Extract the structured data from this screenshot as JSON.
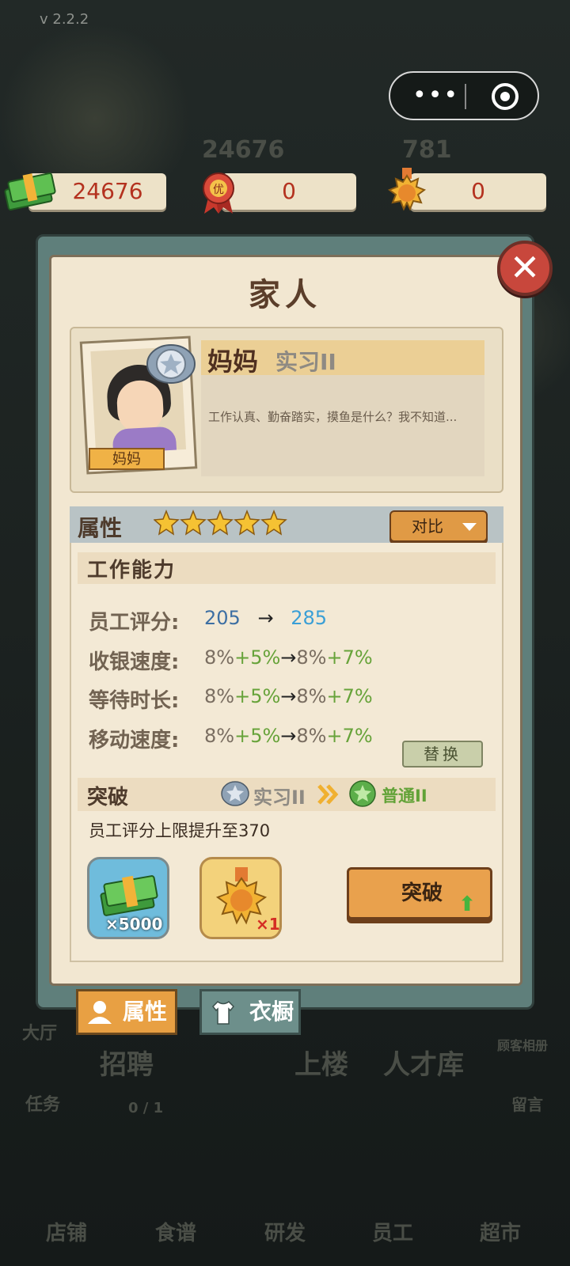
{
  "app": {
    "version": "v 2.2.2"
  },
  "background_hud": {
    "cash_dim": "24676",
    "gems_dim": "781",
    "nav_labels": [
      "店铺",
      "食谱",
      "研发",
      "员工",
      "超市"
    ],
    "side_left": [
      "大厅",
      "任务"
    ],
    "side_right": [
      "顾客相册",
      "留言"
    ],
    "buttons": [
      "招聘",
      "上楼",
      "人才库"
    ],
    "recruit_count": "0 / 1"
  },
  "resources": {
    "cash": "24676",
    "coupon": "0",
    "medal": "0"
  },
  "dialog": {
    "title": "家人",
    "profile": {
      "photo_label": "妈妈",
      "name": "妈妈",
      "rank": "实习II",
      "description": "工作认真、勤奋踏实，摸鱼是什么？我不知道..."
    },
    "attributes": {
      "title": "属性",
      "stars": 5,
      "compare_label": "对比",
      "section_title": "工作能力",
      "stats": [
        {
          "label": "员工评分:",
          "base": "205",
          "arrow": "→",
          "new": "285"
        },
        {
          "label": "收银速度:",
          "base": "8%",
          "bonus": "+5%",
          "arrow": "→",
          "new_base": "8%",
          "new_bonus": "+7%"
        },
        {
          "label": "等待时长:",
          "base": "8%",
          "bonus": "+5%",
          "arrow": "→",
          "new_base": "8%",
          "new_bonus": "+7%"
        },
        {
          "label": "移动速度:",
          "base": "8%",
          "bonus": "+5%",
          "arrow": "→",
          "new_base": "8%",
          "new_bonus": "+7%"
        }
      ],
      "replace_label": "替换"
    },
    "breakthrough": {
      "title": "突破",
      "from_rank": "实习II",
      "to_rank": "普通II",
      "description": "员工评分上限提升至370",
      "costs": [
        {
          "icon": "cash-stack-icon",
          "count": "×5000"
        },
        {
          "icon": "medal-icon",
          "count": "×1"
        }
      ],
      "button_label": "突破"
    },
    "tabs": [
      {
        "label": "属性",
        "active": true
      },
      {
        "label": "衣橱",
        "active": false
      }
    ]
  },
  "colors": {
    "accent_orange": "#e9a14d",
    "paper": "#f2e7d1",
    "panel": "#5f7f7b",
    "close_red": "#c8473c",
    "stat_green": "#67a33a",
    "stat_blue": "#3a9fd6"
  }
}
